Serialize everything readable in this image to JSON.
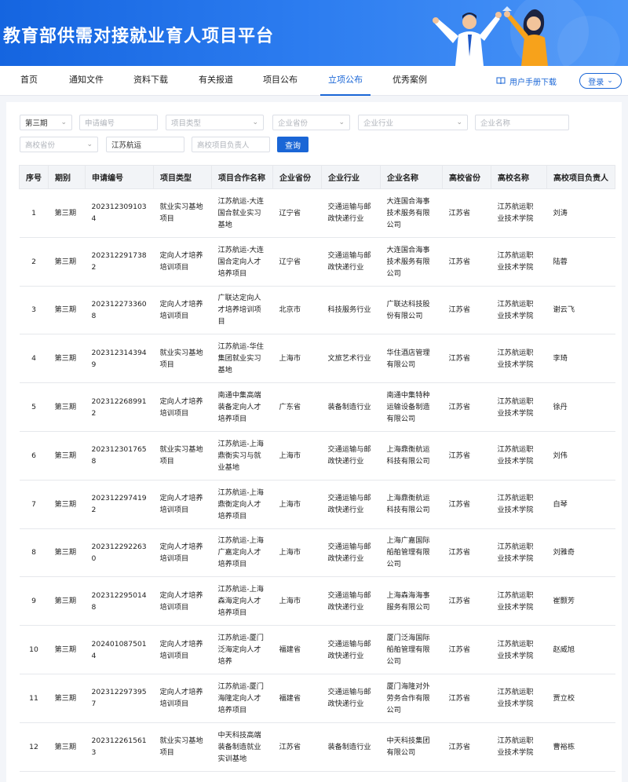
{
  "header": {
    "title": "教育部供需对接就业育人项目平台"
  },
  "nav": {
    "items": [
      "首页",
      "通知文件",
      "资料下载",
      "有关报道",
      "项目公布",
      "立项公布",
      "优秀案例"
    ],
    "active_index": 5,
    "manual_label": "用户手册下载",
    "login_label": "登录"
  },
  "filters": {
    "period": "第三期",
    "apply_no_placeholder": "申请编号",
    "project_type_placeholder": "项目类型",
    "company_province_placeholder": "企业省份",
    "company_industry_placeholder": "企业行业",
    "company_name_placeholder": "企业名称",
    "school_province_placeholder": "高校省份",
    "keyword_value": "江苏航运",
    "leader_placeholder": "高校项目负责人",
    "query_label": "查询"
  },
  "table": {
    "columns": [
      "序号",
      "期别",
      "申请编号",
      "项目类型",
      "项目合作名称",
      "企业省份",
      "企业行业",
      "企业名称",
      "高校省份",
      "高校名称",
      "高校项目负责人"
    ],
    "rows": [
      [
        "1",
        "第三期",
        "2023123091034",
        "就业实习基地项目",
        "江苏航运-大连国合就业实习基地",
        "辽宁省",
        "交通运输与邮政快递行业",
        "大连国合海事技术服务有限公司",
        "江苏省",
        "江苏航运职业技术学院",
        "刘涛"
      ],
      [
        "2",
        "第三期",
        "2023122917382",
        "定向人才培养培训项目",
        "江苏航运-大连国合定向人才培养项目",
        "辽宁省",
        "交通运输与邮政快递行业",
        "大连国合海事技术服务有限公司",
        "江苏省",
        "江苏航运职业技术学院",
        "陆蓉"
      ],
      [
        "3",
        "第三期",
        "2023122733608",
        "定向人才培养培训项目",
        "广联达定向人才培养培训项目",
        "北京市",
        "科技服务行业",
        "广联达科技股份有限公司",
        "江苏省",
        "江苏航运职业技术学院",
        "谢云飞"
      ],
      [
        "4",
        "第三期",
        "2023123143949",
        "就业实习基地项目",
        "江苏航运-华住集团就业实习基地",
        "上海市",
        "文旅艺术行业",
        "华住酒店管理有限公司",
        "江苏省",
        "江苏航运职业技术学院",
        "李琦"
      ],
      [
        "5",
        "第三期",
        "2023122689912",
        "定向人才培养培训项目",
        "南通中集高端装备定向人才培养项目",
        "广东省",
        "装备制造行业",
        "南通中集特种运输设备制造有限公司",
        "江苏省",
        "江苏航运职业技术学院",
        "徐丹"
      ],
      [
        "6",
        "第三期",
        "2023123017658",
        "就业实习基地项目",
        "江苏航运-上海鼎衡实习与就业基地",
        "上海市",
        "交通运输与邮政快递行业",
        "上海鼎衡航运科技有限公司",
        "江苏省",
        "江苏航运职业技术学院",
        "刘伟"
      ],
      [
        "7",
        "第三期",
        "2023122974192",
        "定向人才培养培训项目",
        "江苏航运-上海鼎衡定向人才培养项目",
        "上海市",
        "交通运输与邮政快递行业",
        "上海鼎衡航运科技有限公司",
        "江苏省",
        "江苏航运职业技术学院",
        "白琴"
      ],
      [
        "8",
        "第三期",
        "2023122922630",
        "定向人才培养培训项目",
        "江苏航运-上海广嘉定向人才培养项目",
        "上海市",
        "交通运输与邮政快递行业",
        "上海广嘉国际船舶管理有限公司",
        "江苏省",
        "江苏航运职业技术学院",
        "刘雅奇"
      ],
      [
        "9",
        "第三期",
        "2023122950148",
        "定向人才培养培训项目",
        "江苏航运-上海森海定向人才培养项目",
        "上海市",
        "交通运输与邮政快递行业",
        "上海森海海事服务有限公司",
        "江苏省",
        "江苏航运职业技术学院",
        "崔颢芳"
      ],
      [
        "10",
        "第三期",
        "2024010875014",
        "定向人才培养培训项目",
        "江苏航运-厦门泛海定向人才培养",
        "福建省",
        "交通运输与邮政快递行业",
        "厦门泛海国际船舶管理有限公司",
        "江苏省",
        "江苏航运职业技术学院",
        "赵威旭"
      ],
      [
        "11",
        "第三期",
        "2023122973957",
        "定向人才培养培训项目",
        "江苏航运-厦门海隆定向人才培养项目",
        "福建省",
        "交通运输与邮政快递行业",
        "厦门海隆对外劳务合作有限公司",
        "江苏省",
        "江苏航运职业技术学院",
        "贾立校"
      ],
      [
        "12",
        "第三期",
        "2023122615613",
        "就业实习基地项目",
        "中天科技高端装备制造就业实训基地",
        "江苏省",
        "装备制造行业",
        "中天科技集团有限公司",
        "江苏省",
        "江苏航运职业技术学院",
        "曹裕栋"
      ]
    ]
  },
  "colors": {
    "primary": "#1a66d6",
    "banner": "#2d7df0",
    "header_bg": "#f2f4f7"
  }
}
